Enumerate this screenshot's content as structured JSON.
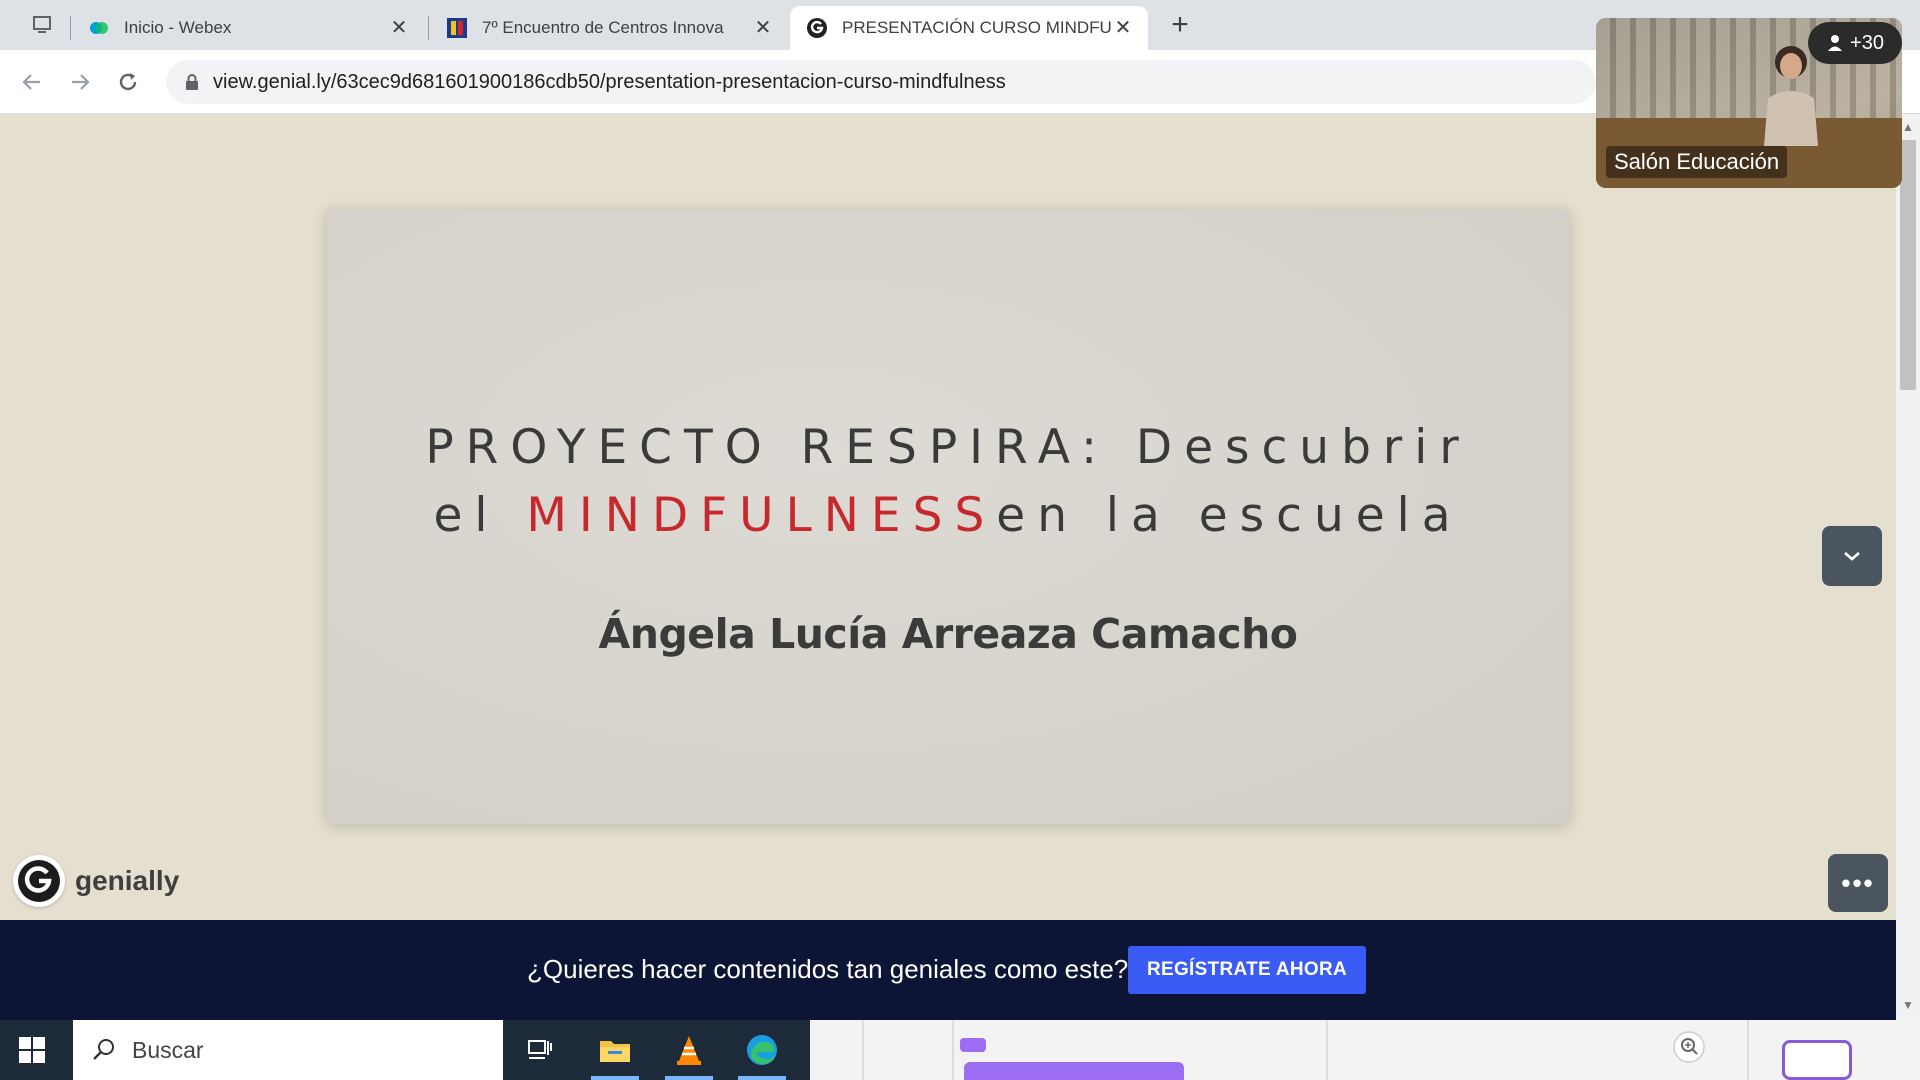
{
  "browser": {
    "tabs": [
      {
        "label": "Inicio - Webex",
        "active": false
      },
      {
        "label": "7º Encuentro de Centros Innova",
        "active": false
      },
      {
        "label": "PRESENTACIÓN CURSO MINDFU",
        "active": true
      }
    ],
    "url": "view.genial.ly/63cec9d681601900186cdb50/presentation-presentacion-curso-mindfulness"
  },
  "slide": {
    "title_line1": "PROYECTO RESPIRA: Descubrir",
    "title_line2_pre": "el ",
    "title_line2_highlight": "MINDFULNESS",
    "title_line2_post": "en la escuela",
    "author": "Ángela Lucía Arreaza Camacho"
  },
  "brand": {
    "name": "genially"
  },
  "banner": {
    "text": "¿Quieres hacer contenidos tan geniales como este?",
    "cta": "REGÍSTRATE AHORA"
  },
  "video": {
    "room_name": "Salón Educación",
    "participants": "+30"
  },
  "taskbar": {
    "search_placeholder": "Buscar"
  },
  "colors": {
    "highlight": "#c7282d",
    "banner_bg": "#0c1536",
    "cta_bg": "#3b5bf5",
    "page_bg": "#e4dfcf"
  }
}
